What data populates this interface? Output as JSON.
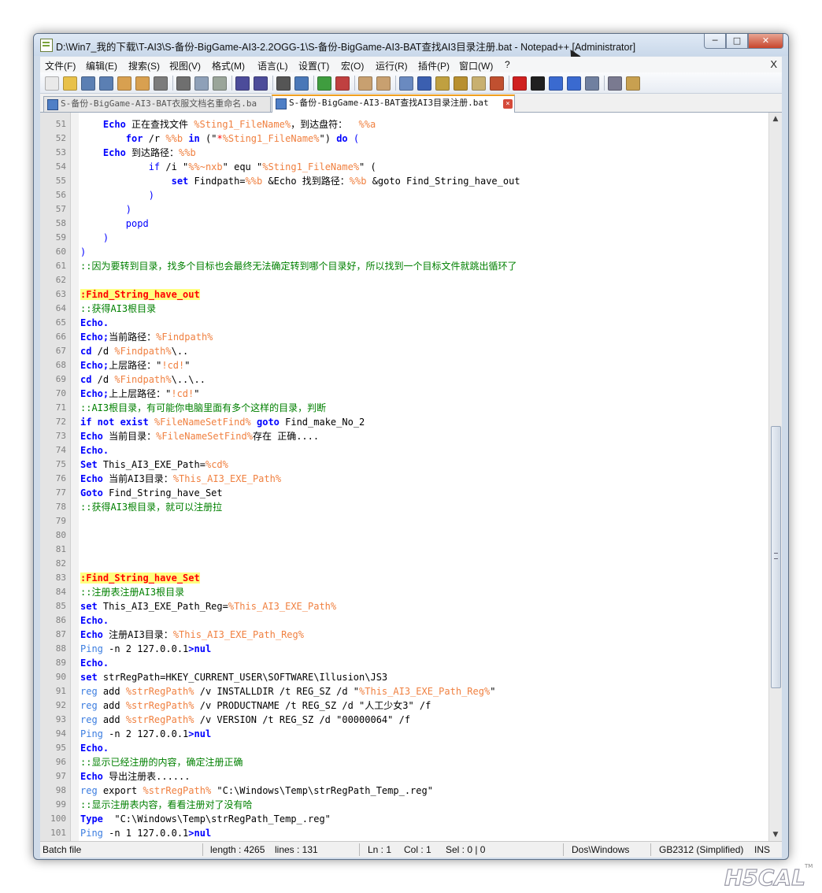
{
  "window": {
    "title": "D:\\Win7_我的下载\\T-AI3\\S-备份-BigGame-AI3-2.2OGG-1\\S-备份-BigGame-AI3-BAT查找AI3目录注册.bat - Notepad++ [Administrator]",
    "buttons": {
      "minimize": "─",
      "maximize": "□",
      "close": "✕"
    }
  },
  "menu": {
    "items": [
      "文件(F)",
      "编辑(E)",
      "搜索(S)",
      "视图(V)",
      "格式(M)",
      "语言(L)",
      "设置(T)",
      "宏(O)",
      "运行(R)",
      "插件(P)",
      "窗口(W)",
      "?"
    ],
    "close_label": "X"
  },
  "toolbar": {
    "icons": [
      "new-file-icon",
      "open-file-icon",
      "save-icon",
      "save-all-icon",
      "close-icon",
      "close-all-icon",
      "print-icon",
      "cut-icon",
      "copy-icon",
      "paste-icon",
      "undo-icon",
      "redo-icon",
      "find-icon",
      "replace-icon",
      "zoom-in-icon",
      "zoom-out-icon",
      "sync-vertical-icon",
      "sync-horizontal-icon",
      "word-wrap-icon",
      "show-all-chars-icon",
      "indent-guide-icon",
      "user-lang-icon",
      "doc-map-icon",
      "function-list-icon",
      "record-macro-icon",
      "stop-macro-icon",
      "play-macro-icon",
      "run-macro-multiple-icon",
      "save-macro-icon",
      "spell-check-icon",
      "hex-icon"
    ]
  },
  "tabs": [
    {
      "label": "S-备份-BigGame-AI3-BAT衣服文档名重命名.ba",
      "active": false
    },
    {
      "label": "S-备份-BigGame-AI3-BAT查找AI3目录注册.bat",
      "active": true
    }
  ],
  "editor": {
    "lines": [
      {
        "n": "51",
        "s": [
          [
            "    ",
            ""
          ],
          [
            "Echo",
            "kw"
          ],
          [
            " 正在查找文件 ",
            ""
          ],
          [
            "%Sting1_FileName%",
            "var"
          ],
          [
            "，到达盘符：  ",
            ""
          ],
          [
            "%%a",
            "var"
          ]
        ]
      },
      {
        "n": "52",
        "s": [
          [
            "        ",
            ""
          ],
          [
            "for",
            "kw"
          ],
          [
            " /r ",
            ""
          ],
          [
            "%%b",
            "var"
          ],
          [
            " ",
            ""
          ],
          [
            "in",
            "kw"
          ],
          [
            " (\"",
            ""
          ],
          [
            "*",
            "op"
          ],
          [
            "%Sting1_FileName%",
            "var"
          ],
          [
            "\") ",
            ""
          ],
          [
            "do",
            "kw"
          ],
          [
            " (",
            "par"
          ]
        ]
      },
      {
        "n": "53",
        "s": [
          [
            "    ",
            ""
          ],
          [
            "Echo",
            "kw"
          ],
          [
            " 到达路径：",
            ""
          ],
          [
            "%%b",
            "var"
          ]
        ]
      },
      {
        "n": "54",
        "s": [
          [
            "            ",
            ""
          ],
          [
            "if",
            "kw2"
          ],
          [
            " /i \"",
            ""
          ],
          [
            "%%~nxb",
            "var"
          ],
          [
            "\" equ \"",
            ""
          ],
          [
            "%Sting1_FileName%",
            "var"
          ],
          [
            "\" (",
            ""
          ]
        ]
      },
      {
        "n": "55",
        "s": [
          [
            "                ",
            ""
          ],
          [
            "set",
            "kw"
          ],
          [
            " Findpath=",
            ""
          ],
          [
            "%%b",
            "var"
          ],
          [
            " &Echo 找到路径：",
            ""
          ],
          [
            "%%b",
            "var"
          ],
          [
            " &goto Find_String_have_out",
            ""
          ]
        ]
      },
      {
        "n": "56",
        "s": [
          [
            "            ",
            ""
          ],
          [
            ")",
            "par"
          ]
        ]
      },
      {
        "n": "57",
        "s": [
          [
            "        ",
            ""
          ],
          [
            ")",
            "par"
          ]
        ]
      },
      {
        "n": "58",
        "s": [
          [
            "        ",
            ""
          ],
          [
            "popd",
            "kw2"
          ]
        ]
      },
      {
        "n": "59",
        "s": [
          [
            "    ",
            ""
          ],
          [
            ")",
            "par"
          ]
        ]
      },
      {
        "n": "60",
        "s": [
          [
            ")",
            "par"
          ]
        ]
      },
      {
        "n": "61",
        "s": [
          [
            "::因为要转到目录，找多个目标也会最终无法确定转到哪个目录好，所以找到一个目标文件就跳出循环了",
            "cmt"
          ]
        ]
      },
      {
        "n": "62",
        "s": []
      },
      {
        "n": "63",
        "s": [
          [
            ":Find_String_have_out",
            "lbl"
          ]
        ]
      },
      {
        "n": "64",
        "s": [
          [
            "::获得AI3根目录",
            "cmt"
          ]
        ]
      },
      {
        "n": "65",
        "s": [
          [
            "Echo.",
            "kw"
          ]
        ]
      },
      {
        "n": "66",
        "s": [
          [
            "Echo;",
            "kw"
          ],
          [
            "当前路径：",
            ""
          ],
          [
            "%Findpath%",
            "var"
          ]
        ]
      },
      {
        "n": "67",
        "s": [
          [
            "cd",
            "kw"
          ],
          [
            " /d ",
            ""
          ],
          [
            "%Findpath%",
            "var"
          ],
          [
            "\\..",
            ""
          ]
        ]
      },
      {
        "n": "68",
        "s": [
          [
            "Echo;",
            "kw"
          ],
          [
            "上层路径：\"",
            ""
          ],
          [
            "!cd!",
            "var"
          ],
          [
            "\"",
            ""
          ]
        ]
      },
      {
        "n": "69",
        "s": [
          [
            "cd",
            "kw"
          ],
          [
            " /d ",
            ""
          ],
          [
            "%Findpath%",
            "var"
          ],
          [
            "\\..\\..",
            ""
          ]
        ]
      },
      {
        "n": "70",
        "s": [
          [
            "Echo;",
            "kw"
          ],
          [
            "上上层路径：\"",
            ""
          ],
          [
            "!cd!",
            "var"
          ],
          [
            "\"",
            ""
          ]
        ]
      },
      {
        "n": "71",
        "s": [
          [
            "::AI3根目录，有可能你电脑里面有多个这样的目录，判断",
            "cmt"
          ]
        ]
      },
      {
        "n": "72",
        "s": [
          [
            "if not exist",
            "kw"
          ],
          [
            " ",
            ""
          ],
          [
            "%FileNameSetFind%",
            "var"
          ],
          [
            " ",
            ""
          ],
          [
            "goto",
            "kw"
          ],
          [
            " Find_make_No_2",
            ""
          ]
        ]
      },
      {
        "n": "73",
        "s": [
          [
            "Echo",
            "kw"
          ],
          [
            " 当前目录：",
            ""
          ],
          [
            "%FileNameSetFind%",
            "var"
          ],
          [
            "存在 正确....",
            ""
          ]
        ]
      },
      {
        "n": "74",
        "s": [
          [
            "Echo.",
            "kw"
          ]
        ]
      },
      {
        "n": "75",
        "s": [
          [
            "Set",
            "kw"
          ],
          [
            " This_AI3_EXE_Path=",
            ""
          ],
          [
            "%cd%",
            "var"
          ]
        ]
      },
      {
        "n": "76",
        "s": [
          [
            "Echo",
            "kw"
          ],
          [
            " 当前AI3目录：",
            ""
          ],
          [
            "%This_AI3_EXE_Path%",
            "var"
          ]
        ]
      },
      {
        "n": "77",
        "s": [
          [
            "Goto",
            "kw"
          ],
          [
            " Find_String_have_Set",
            ""
          ]
        ]
      },
      {
        "n": "78",
        "s": [
          [
            "::获得AI3根目录，就可以注册拉",
            "cmt"
          ]
        ]
      },
      {
        "n": "79",
        "s": []
      },
      {
        "n": "80",
        "s": []
      },
      {
        "n": "81",
        "s": []
      },
      {
        "n": "82",
        "s": []
      },
      {
        "n": "83",
        "s": [
          [
            ":Find_String_have_Set",
            "lbl"
          ]
        ]
      },
      {
        "n": "84",
        "s": [
          [
            "::注册表注册AI3根目录",
            "cmt"
          ]
        ]
      },
      {
        "n": "85",
        "s": [
          [
            "set",
            "kw"
          ],
          [
            " This_AI3_EXE_Path_Reg=",
            ""
          ],
          [
            "%This_AI3_EXE_Path%",
            "var"
          ]
        ]
      },
      {
        "n": "86",
        "s": [
          [
            "Echo.",
            "kw"
          ]
        ]
      },
      {
        "n": "87",
        "s": [
          [
            "Echo",
            "kw"
          ],
          [
            " 注册AI3目录：",
            ""
          ],
          [
            "%This_AI3_EXE_Path_Reg%",
            "var"
          ]
        ]
      },
      {
        "n": "88",
        "s": [
          [
            "Ping",
            "ping"
          ],
          [
            " -n 2 127.0.0.1",
            ""
          ],
          [
            ">nul",
            "kw"
          ]
        ]
      },
      {
        "n": "89",
        "s": [
          [
            "Echo.",
            "kw"
          ]
        ]
      },
      {
        "n": "90",
        "s": [
          [
            "set",
            "kw"
          ],
          [
            " strRegPath=HKEY_CURRENT_USER\\SOFTWARE\\Illusion\\JS3",
            ""
          ]
        ]
      },
      {
        "n": "91",
        "s": [
          [
            "reg",
            "ping"
          ],
          [
            " add ",
            ""
          ],
          [
            "%strRegPath%",
            "var"
          ],
          [
            " /v INSTALLDIR /t REG_SZ /d \"",
            ""
          ],
          [
            "%This_AI3_EXE_Path_Reg%",
            "var"
          ],
          [
            "\"",
            ""
          ]
        ]
      },
      {
        "n": "92",
        "s": [
          [
            "reg",
            "ping"
          ],
          [
            " add ",
            ""
          ],
          [
            "%strRegPath%",
            "var"
          ],
          [
            " /v PRODUCTNAME /t REG_SZ /d \"人工少女3\" /f",
            ""
          ]
        ]
      },
      {
        "n": "93",
        "s": [
          [
            "reg",
            "ping"
          ],
          [
            " add ",
            ""
          ],
          [
            "%strRegPath%",
            "var"
          ],
          [
            " /v VERSION /t REG_SZ /d \"00000064\" /f",
            ""
          ]
        ]
      },
      {
        "n": "94",
        "s": [
          [
            "Ping",
            "ping"
          ],
          [
            " -n 2 127.0.0.1",
            ""
          ],
          [
            ">nul",
            "kw"
          ]
        ]
      },
      {
        "n": "95",
        "s": [
          [
            "Echo.",
            "kw"
          ]
        ]
      },
      {
        "n": "96",
        "s": [
          [
            "::显示已经注册的内容，确定注册正确",
            "cmt"
          ]
        ]
      },
      {
        "n": "97",
        "s": [
          [
            "Echo",
            "kw"
          ],
          [
            " 导出注册表......",
            ""
          ]
        ]
      },
      {
        "n": "98",
        "s": [
          [
            "reg",
            "ping"
          ],
          [
            " export ",
            ""
          ],
          [
            "%strRegPath%",
            "var"
          ],
          [
            " \"C:\\Windows\\Temp\\strRegPath_Temp_.reg\"",
            ""
          ]
        ]
      },
      {
        "n": "99",
        "s": [
          [
            "::显示注册表内容，看看注册对了没有哈",
            "cmt"
          ]
        ]
      },
      {
        "n": "100",
        "s": [
          [
            "Type",
            "kw"
          ],
          [
            "  \"C:\\Windows\\Temp\\strRegPath_Temp_.reg\"",
            ""
          ]
        ]
      },
      {
        "n": "101",
        "s": [
          [
            "Ping",
            "ping"
          ],
          [
            " -n 1 127.0.0.1",
            ""
          ],
          [
            ">nul",
            "kw"
          ]
        ]
      }
    ]
  },
  "scrollbar": {
    "up": "▲",
    "down": "▼"
  },
  "status": {
    "file_type": "Batch file",
    "length": "length : 4265",
    "lines": "lines : 131",
    "ln": "Ln : 1",
    "col": "Col : 1",
    "sel": "Sel : 0 | 0",
    "eol": "Dos\\Windows",
    "encoding": "GB2312 (Simplified)",
    "mode": "INS"
  },
  "watermark": {
    "text": "H5CAL",
    "tm": "TM"
  }
}
